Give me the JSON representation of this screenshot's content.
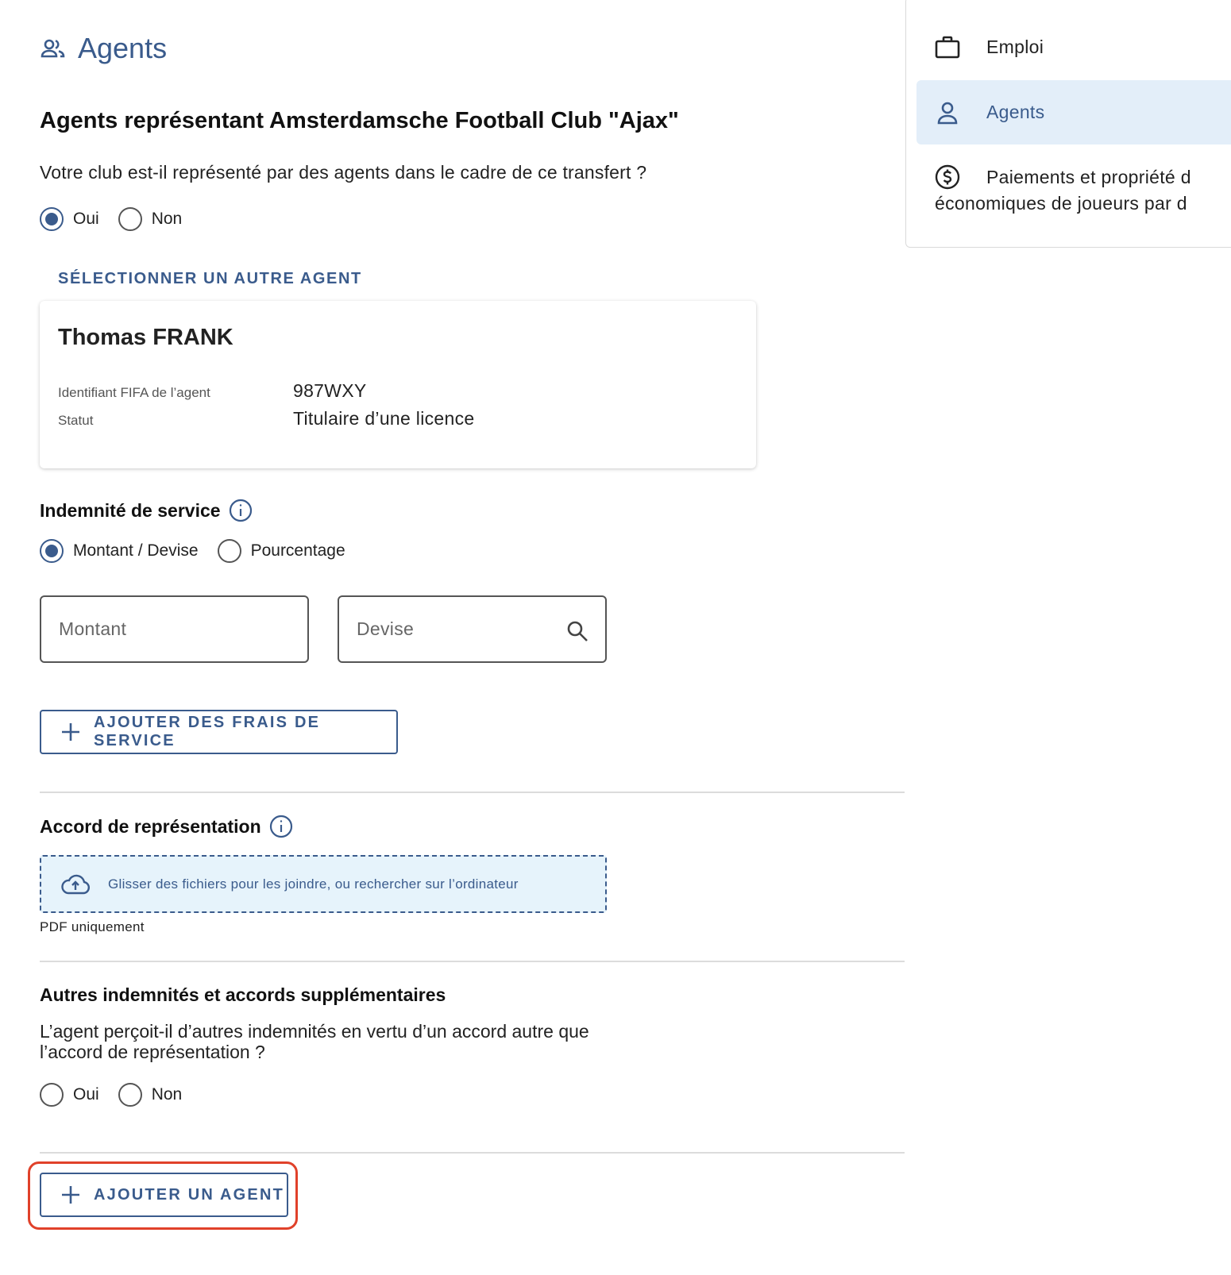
{
  "header": {
    "title": "Agents",
    "icon": "people-icon"
  },
  "section": {
    "heading": "Agents représentant Amsterdamsche Football Club \"Ajax\"",
    "question": "Votre club est-il représenté par des agents dans le cadre de ce transfert ?",
    "represented_options": [
      "Oui",
      "Non"
    ],
    "represented_selected": "Oui"
  },
  "select_other_agent_link": "SÉLECTIONNER UN AUTRE AGENT",
  "agent_card": {
    "name": "Thomas FRANK",
    "fields": [
      {
        "label": "Identifiant FIFA de l’agent",
        "value": "987WXY"
      },
      {
        "label": "Statut",
        "value": "Titulaire d’une licence"
      }
    ]
  },
  "service_fee": {
    "heading": "Indemnité de service",
    "options": [
      "Montant / Devise",
      "Pourcentage"
    ],
    "selected": "Montant / Devise",
    "amount_placeholder": "Montant",
    "currency_placeholder": "Devise",
    "add_button_label": "AJOUTER DES FRAIS DE SERVICE"
  },
  "representation_agreement": {
    "heading": "Accord de représentation",
    "dropzone_text": "Glisser des fichiers pour les joindre, ou rechercher sur l’ordinateur",
    "hint": "PDF uniquement"
  },
  "other_fees": {
    "heading": "Autres indemnités et accords supplémentaires",
    "question": "L’agent perçoit-il d’autres indemnités en vertu d’un accord autre que l’accord de représentation ?",
    "options": [
      "Oui",
      "Non"
    ],
    "selected": null
  },
  "add_agent_button_label": "AJOUTER UN AGENT",
  "sidebar": {
    "items": [
      {
        "label": "Emploi",
        "icon": "briefcase-icon",
        "active": false
      },
      {
        "label": "Agents",
        "icon": "person-icon",
        "active": true
      },
      {
        "label": "Paiements et propriété d",
        "label_line2": "économiques de joueurs par d",
        "icon": "dollar-circle-icon",
        "active": false
      }
    ]
  },
  "colors": {
    "accent": "#3a5b8c",
    "active_bg": "#e3eef9",
    "dropzone_bg": "#e6f3fb",
    "highlight": "#e0412a"
  }
}
